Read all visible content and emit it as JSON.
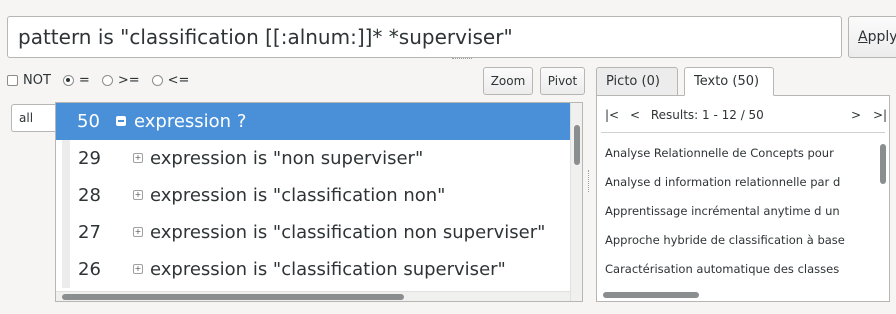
{
  "query": {
    "value": "pattern is \"classification [[:alnum:]]* *superviser\""
  },
  "apply": {
    "underlined": "A",
    "rest": "pply"
  },
  "options": {
    "not_label": "NOT",
    "eq_label": "=",
    "ge_label": ">=",
    "le_label": "<=",
    "selected": "="
  },
  "toolbar": {
    "zoom_label": "Zoom",
    "pivot_label": "Pivot"
  },
  "side_tab": {
    "label": "all"
  },
  "tree": {
    "rows": [
      {
        "count": "50",
        "label": "expression ?",
        "selected": true
      },
      {
        "count": "29",
        "label": "expression is \"non superviser\""
      },
      {
        "count": "28",
        "label": "expression is \"classification non\""
      },
      {
        "count": "27",
        "label": "expression is \"classification non superviser\""
      },
      {
        "count": "26",
        "label": "expression is \"classification superviser\""
      }
    ]
  },
  "tabs": [
    {
      "label": "Picto (0)",
      "active": false
    },
    {
      "label": "Texto (50)",
      "active": true
    }
  ],
  "results": {
    "first": "|<",
    "prev": "<",
    "summary": "Results: 1 - 12 / 50",
    "next": ">",
    "last": ">|",
    "items": [
      "Analyse Relationnelle de Concepts pour",
      "Analyse d information relationnelle par d",
      "Apprentissage incrémental anytime d un",
      "Approche hybride de classification à base",
      "Caractérisation automatique des classes"
    ]
  }
}
